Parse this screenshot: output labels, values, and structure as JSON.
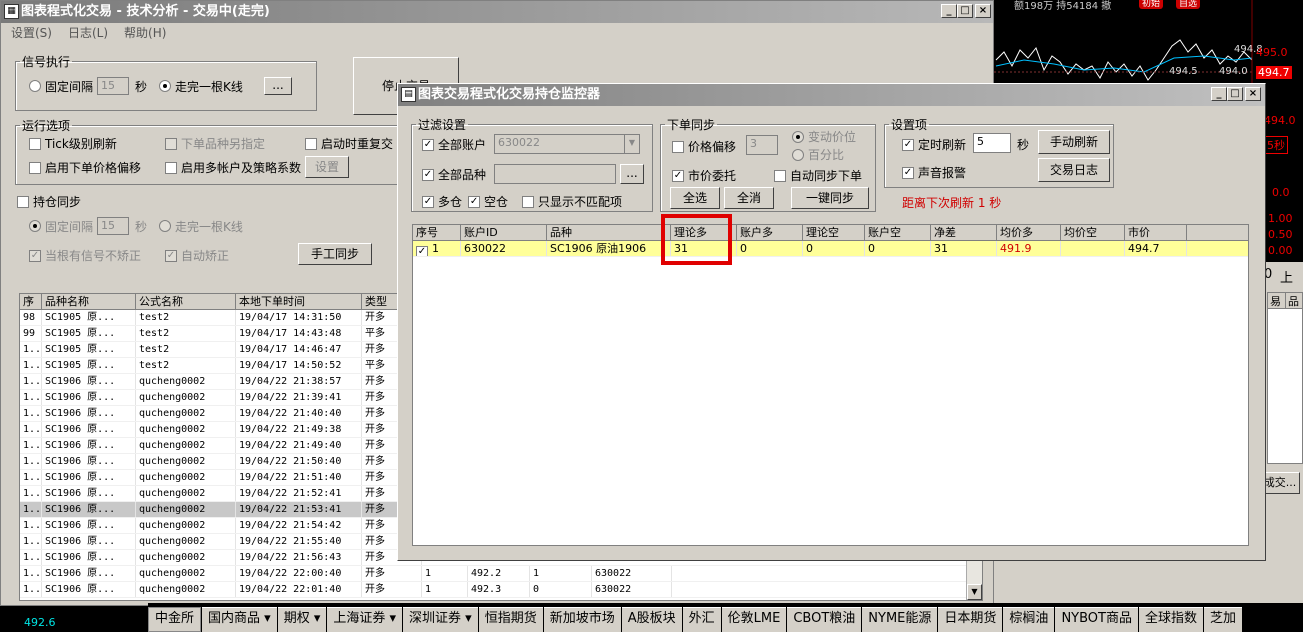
{
  "chart_ticker": {
    "top_text": "额198万 持54184 撤",
    "badge1": "初始",
    "badge2": "自选",
    "ticks": [
      "495.0",
      "494.7",
      "494.0",
      "5秒",
      "0.0",
      "1.00",
      "0.50",
      "0.00"
    ],
    "lbl_a": "494.8",
    "lbl_b": "494.5",
    "lbl_c": "494.0"
  },
  "bottom_left_price": "492.6",
  "right_labels": {
    "up": "上",
    "num0": "0",
    "hdr_a": "易",
    "hdr_b": "品",
    "deal_btn": "成交..."
  },
  "main_window": {
    "title": "图表程式化交易 - 技术分析 - 交易中(走完)",
    "menu": [
      "设置(S)",
      "日志(L)",
      "帮助(H)"
    ],
    "signal": {
      "legend": "信号执行",
      "fixed_interval": "固定间隔",
      "interval_value": "15",
      "sec": "秒",
      "bar_complete": "走完一根K线",
      "dots": "...",
      "stop_btn": "停止交易"
    },
    "run": {
      "legend": "运行选项",
      "tick_refresh": "Tick级别刷新",
      "order_other": "下单品种另指定",
      "restart": "启动时重复交",
      "price_offset": "启用下单价格偏移",
      "multi_account": "启用多帐户及策略系数",
      "settings_btn": "设置"
    },
    "hold": {
      "title": "持仓同步",
      "fixed": "固定间隔",
      "value": "15",
      "sec": "秒",
      "bar": "走完一根K线",
      "no_signal": "当根有信号不矫正",
      "auto_fix": "自动矫正",
      "manual_btn": "手工同步"
    },
    "table": {
      "headers": [
        "序",
        "品种名称",
        "公式名称",
        "本地下单时间",
        "类型"
      ],
      "rows": [
        [
          "98",
          "SC1905 原...",
          "test2",
          "19/04/17 14:31:50",
          "开多"
        ],
        [
          "99",
          "SC1905 原...",
          "test2",
          "19/04/17 14:43:48",
          "平多"
        ],
        [
          "1..",
          "SC1905 原...",
          "test2",
          "19/04/17 14:46:47",
          "开多"
        ],
        [
          "1..",
          "SC1905 原...",
          "test2",
          "19/04/17 14:50:52",
          "平多"
        ],
        [
          "1..",
          "SC1906 原...",
          "qucheng0002",
          "19/04/22 21:38:57",
          "开多"
        ],
        [
          "1..",
          "SC1906 原...",
          "qucheng0002",
          "19/04/22 21:39:41",
          "开多"
        ],
        [
          "1..",
          "SC1906 原...",
          "qucheng0002",
          "19/04/22 21:40:40",
          "开多"
        ],
        [
          "1..",
          "SC1906 原...",
          "qucheng0002",
          "19/04/22 21:49:38",
          "开多"
        ],
        [
          "1..",
          "SC1906 原...",
          "qucheng0002",
          "19/04/22 21:49:40",
          "开多"
        ],
        [
          "1..",
          "SC1906 原...",
          "qucheng0002",
          "19/04/22 21:50:40",
          "开多"
        ],
        [
          "1..",
          "SC1906 原...",
          "qucheng0002",
          "19/04/22 21:51:40",
          "开多"
        ],
        [
          "1..",
          "SC1906 原...",
          "qucheng0002",
          "19/04/22 21:52:41",
          "开多"
        ],
        [
          "1..",
          "SC1906 原...",
          "qucheng0002",
          "19/04/22 21:53:41",
          "开多"
        ],
        [
          "1..",
          "SC1906 原...",
          "qucheng0002",
          "19/04/22 21:54:42",
          "开多"
        ],
        [
          "1..",
          "SC1906 原...",
          "qucheng0002",
          "19/04/22 21:55:40",
          "开多"
        ],
        [
          "1..",
          "SC1906 原...",
          "qucheng0002",
          "19/04/22 21:56:43",
          "开多"
        ],
        [
          "1..",
          "SC1906 原...",
          "qucheng0002",
          "19/04/22 22:00:40",
          "开多"
        ],
        [
          "1..",
          "SC1906 原...",
          "qucheng0002",
          "19/04/22 22:01:40",
          "开多"
        ]
      ],
      "extra_rows": [
        [
          "1",
          "492.2",
          "1",
          "630022"
        ],
        [
          "1",
          "492.3",
          "0",
          "630022"
        ]
      ]
    }
  },
  "monitor": {
    "title": "图表交易程式化交易持仓监控器",
    "filter": {
      "legend": "过滤设置",
      "all_accounts": "全部账户",
      "account": "630022",
      "all_products": "全部品种",
      "more": "...",
      "long": "多仓",
      "short": "空仓",
      "mismatch": "只显示不匹配项"
    },
    "order_sync": {
      "legend": "下单同步",
      "price_offset": "价格偏移",
      "offset_value": "3",
      "opp_price": "变动价位",
      "percent": "百分比",
      "market": "市价委托",
      "auto_sync": "自动同步下单",
      "select_all": "全选",
      "clear_all": "全消",
      "one_key": "一键同步"
    },
    "settings": {
      "legend": "设置项",
      "timed_refresh": "定时刷新",
      "refresh_value": "5",
      "sec": "秒",
      "manual_refresh": "手动刷新",
      "sound": "声音报警",
      "trade_log": "交易日志",
      "countdown": "距离下次刷新 1 秒"
    },
    "grid": {
      "headers": [
        "序号",
        "账户ID",
        "品种",
        "理论多",
        "账户多",
        "理论空",
        "账户空",
        "净差",
        "均价多",
        "均价空",
        "市价"
      ],
      "row": [
        "1",
        "630022",
        "SC1906 原油1906",
        "31",
        "0",
        "0",
        "0",
        "31",
        "491.9",
        "",
        "494.7"
      ]
    }
  },
  "tabs": [
    "中金所",
    "国内商品 ▾",
    "期权 ▾",
    "上海证券 ▾",
    "深圳证券 ▾",
    "恒指期货",
    "新加坡市场",
    "A股板块",
    "外汇",
    "伦敦LME",
    "CBOT粮油",
    "NYME能源",
    "日本期货",
    "棕榈油",
    "NYBOT商品",
    "全球指数",
    "芝加"
  ],
  "colors": {
    "highlight": "#e00000",
    "row_yellow": "#ffff99",
    "red_text": "#d00000"
  }
}
